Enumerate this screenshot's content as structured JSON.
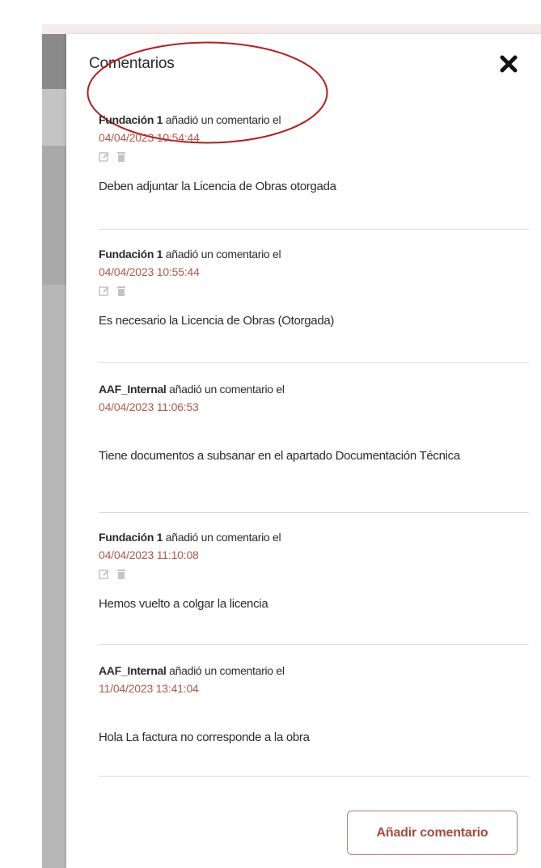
{
  "panel": {
    "title": "Comentarios",
    "close_icon": "close-x-icon",
    "add_button_label": "Añadir comentario"
  },
  "colors": {
    "date": "#b0584e",
    "accent_border": "#b97d75",
    "annotation_circle": "#b41e1e"
  },
  "comments": [
    {
      "author": "Fundación 1",
      "action": "añadió un comentario el",
      "date": "04/04/2023 10:54:44",
      "text": "Deben adjuntar la Licencia de Obras otorgada",
      "editable": true
    },
    {
      "author": "Fundación 1",
      "action": "añadió un comentario el",
      "date": "04/04/2023 10:55:44",
      "text": "Es necesario la Licencia de Obras (Otorgada)",
      "editable": true
    },
    {
      "author": "AAF_Internal",
      "action": "añadió un comentario el",
      "date": "04/04/2023 11:06:53",
      "text": "Tiene documentos a subsanar en el apartado Documentación Técnica",
      "editable": false
    },
    {
      "author": "Fundación 1",
      "action": "añadió un comentario el",
      "date": "04/04/2023 11:10:08",
      "text": "Hemos vuelto a colgar la licencia",
      "editable": true
    },
    {
      "author": "AAF_Internal",
      "action": "añadió un comentario el",
      "date": "11/04/2023 13:41:04",
      "text": "Hola La factura no corresponde a la obra",
      "editable": false
    }
  ]
}
